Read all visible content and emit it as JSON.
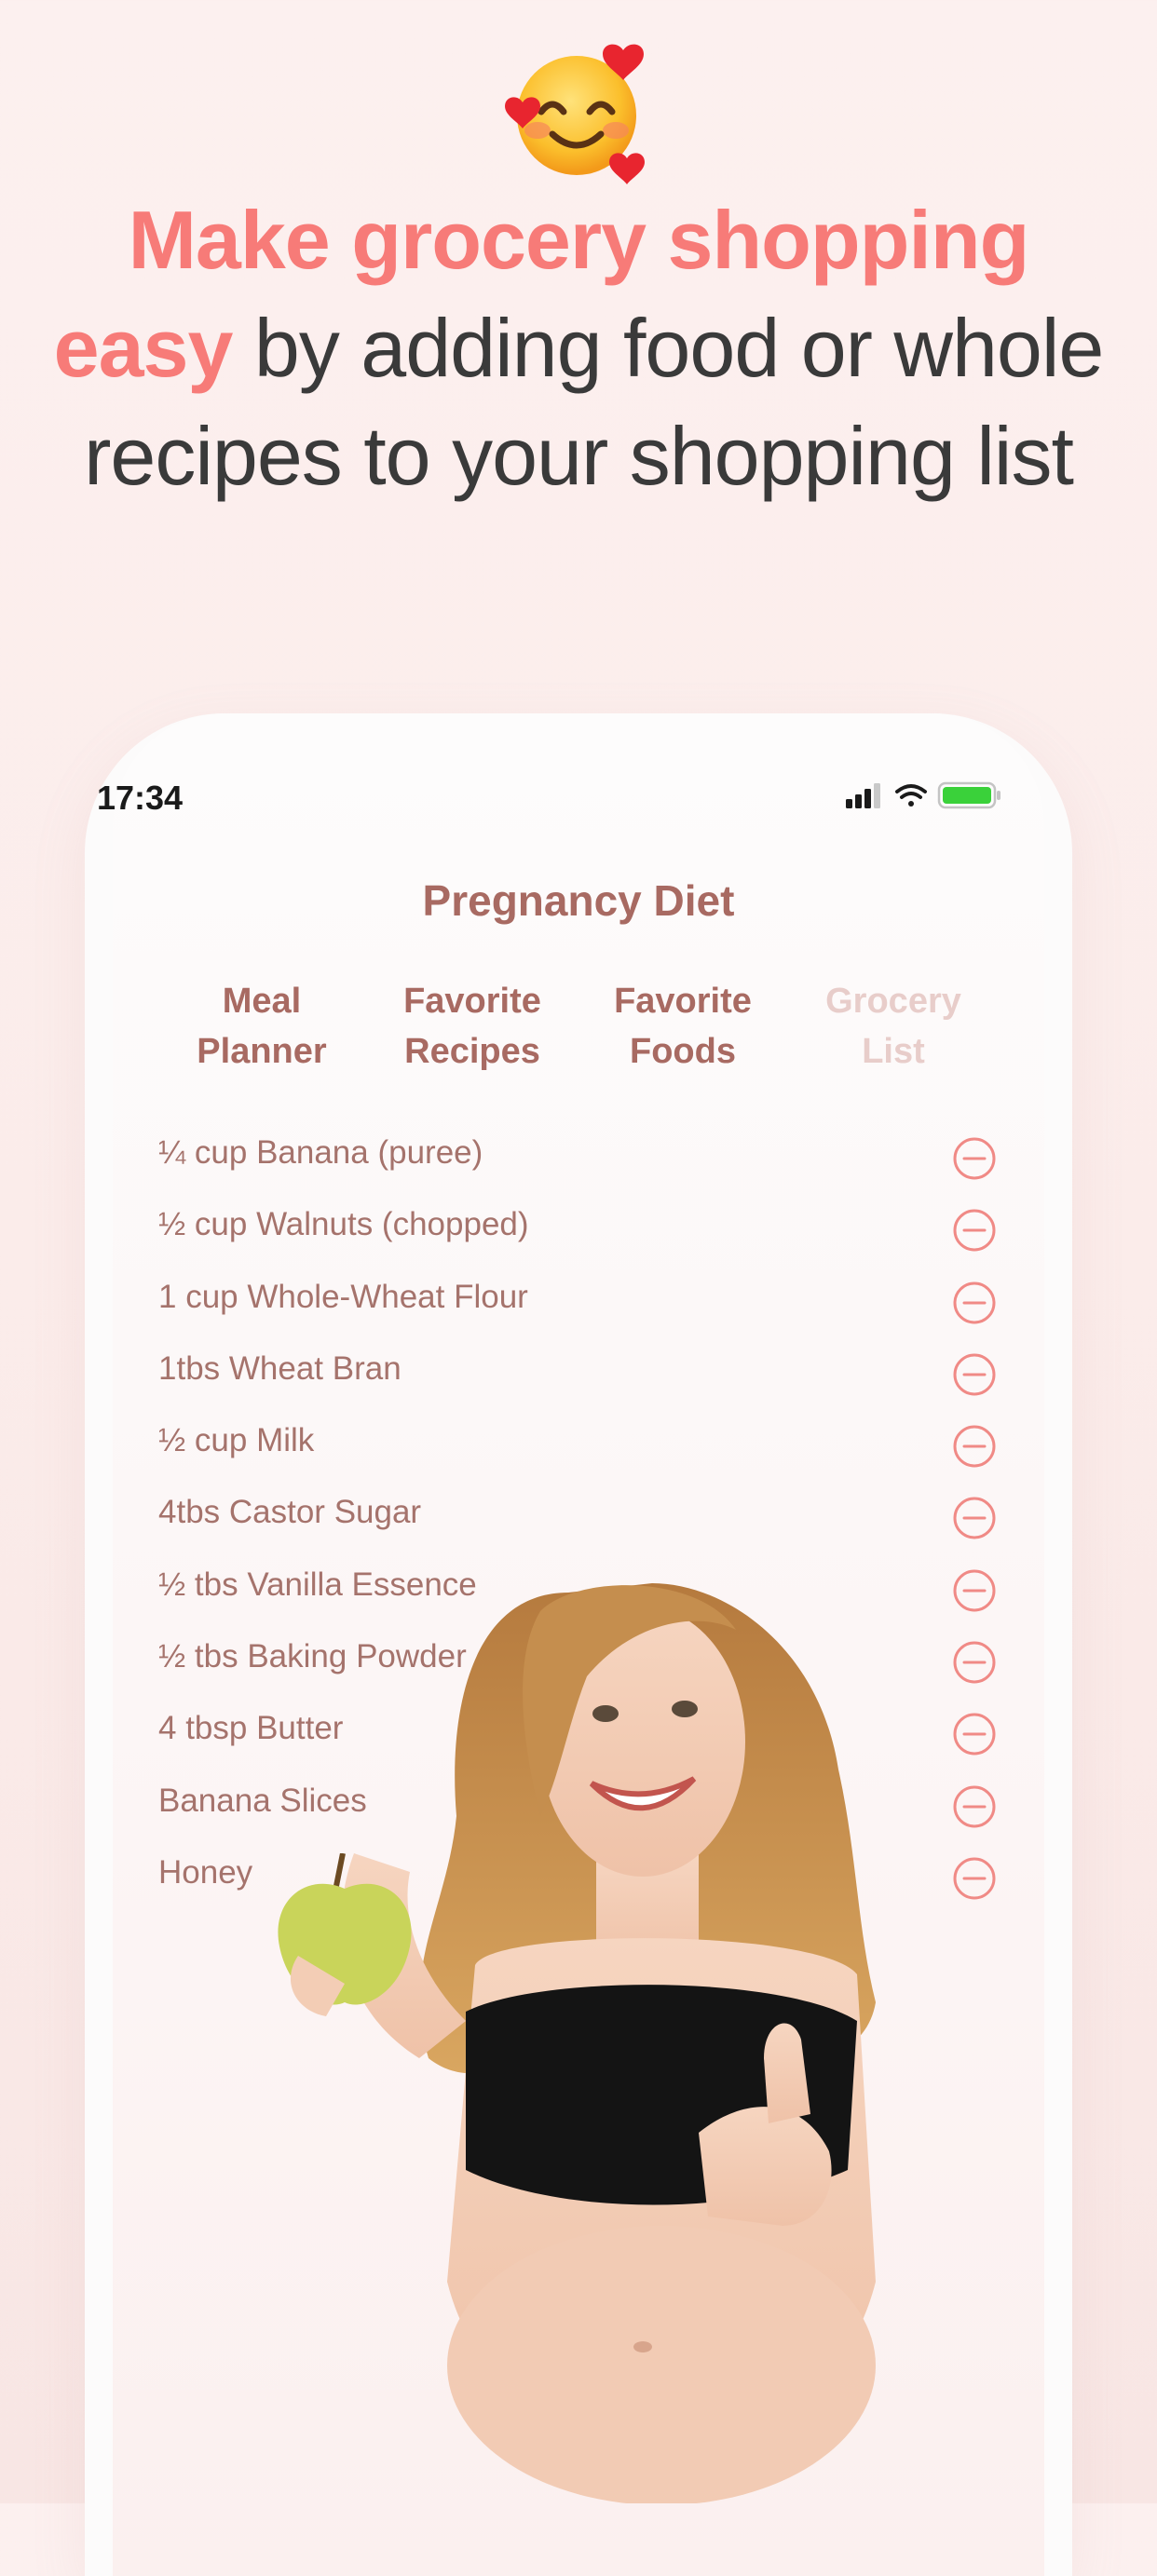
{
  "headline": {
    "highlight": "Make grocery shopping easy",
    "rest": " by adding food or whole recipes to your shopping list"
  },
  "status_bar": {
    "time": "17:34"
  },
  "app": {
    "title": "Pregnancy Diet",
    "tabs": [
      {
        "line1": "Meal",
        "line2": "Planner",
        "active": true
      },
      {
        "line1": "Favorite",
        "line2": "Recipes",
        "active": true
      },
      {
        "line1": "Favorite",
        "line2": "Foods",
        "active": true
      },
      {
        "line1": "Grocery",
        "line2": "List",
        "active": false
      }
    ],
    "grocery_items": [
      "¼ cup Banana (puree)",
      "½ cup Walnuts (chopped)",
      "1 cup Whole-Wheat Flour",
      "1tbs Wheat Bran",
      "½ cup Milk",
      "4tbs Castor Sugar",
      "½ tbs Vanilla Essence",
      "½ tbs Baking Powder",
      "4 tbsp Butter",
      "Banana Slices",
      "Honey"
    ]
  },
  "colors": {
    "accent": "#f77b78",
    "title": "#a86a62",
    "item_text": "#a5736c",
    "remove_icon": "#f08a86",
    "inactive_tab": "#e8cdca"
  },
  "icons": {
    "emoji": "smiling-face-with-hearts-icon",
    "remove": "minus-circle-icon",
    "signal": "signal-icon",
    "wifi": "wifi-icon",
    "battery": "battery-icon"
  }
}
